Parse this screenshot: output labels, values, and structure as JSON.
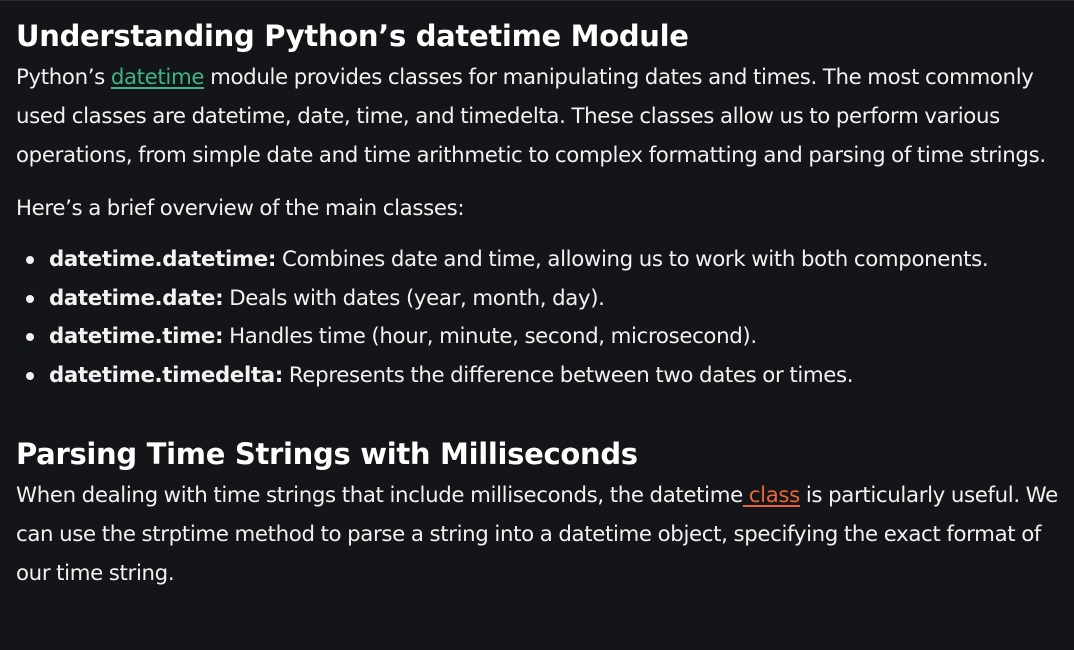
{
  "section1": {
    "heading": "Understanding Python’s datetime Module",
    "intro": {
      "before_link": "Python’s ",
      "link_text": "datetime",
      "after_link": " module provides classes for manipulating dates and times. The most commonly used classes are datetime, date, time, and timedelta. These classes allow us to perform various operations, from simple date and time arithmetic to complex formatting and parsing of time strings."
    },
    "overview": "Here’s a brief overview of the main classes:",
    "classes": [
      {
        "term": "datetime.datetime:",
        "desc": " Combines date and time, allowing us to work with both components."
      },
      {
        "term": "datetime.date:",
        "desc": " Deals with dates (year, month, day)."
      },
      {
        "term": "datetime.time:",
        "desc": " Handles time (hour, minute, second, microsecond)."
      },
      {
        "term": "datetime.timedelta:",
        "desc": " Represents the difference between two dates or times."
      }
    ]
  },
  "section2": {
    "heading": "Parsing Time Strings with Milliseconds",
    "body": {
      "before_link": "When dealing with time strings that include milliseconds, the datetime",
      "link_text": " class",
      "after_link": " is particularly useful. We can use the strptime method to parse a string into a datetime object, specifying the exact format of our time string."
    }
  },
  "colors": {
    "background": "#141518",
    "text": "#f2f2f2",
    "link_green": "#3cb487",
    "link_orange": "#e8653a"
  }
}
